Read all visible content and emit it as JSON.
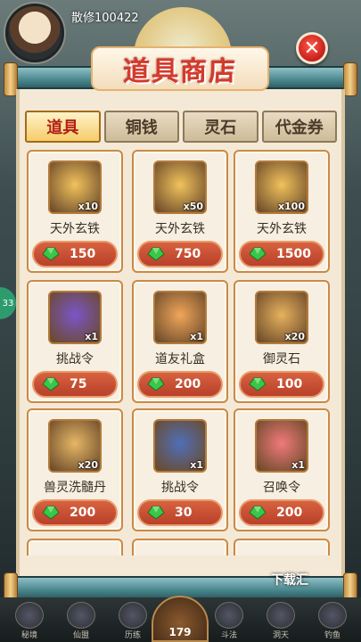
{
  "header": {
    "player_name": "散修100422"
  },
  "shop": {
    "title": "道具商店",
    "close_glyph": "✕"
  },
  "tabs": [
    {
      "label": "道具",
      "active": true
    },
    {
      "label": "铜钱",
      "active": false
    },
    {
      "label": "灵石",
      "active": false
    },
    {
      "label": "代金券",
      "active": false
    }
  ],
  "items": [
    {
      "name": "天外玄铁",
      "qty": "x10",
      "price": "150",
      "icon": "meteor-iron-icon",
      "color": "#f1c25c"
    },
    {
      "name": "天外玄铁",
      "qty": "x50",
      "price": "750",
      "icon": "meteor-iron-icon",
      "color": "#f1c25c"
    },
    {
      "name": "天外玄铁",
      "qty": "x100",
      "price": "1500",
      "icon": "meteor-iron-icon",
      "color": "#f1c25c"
    },
    {
      "name": "挑战令",
      "qty": "x1",
      "price": "75",
      "icon": "challenge-token-icon",
      "color": "#7b55c9"
    },
    {
      "name": "道友礼盒",
      "qty": "x1",
      "price": "200",
      "icon": "gift-box-icon",
      "color": "#f0a65a"
    },
    {
      "name": "御灵石",
      "qty": "x20",
      "price": "100",
      "icon": "spirit-stone-icon",
      "color": "#e7b15e"
    },
    {
      "name": "兽灵洗髓丹",
      "qty": "x20",
      "price": "200",
      "icon": "pill-icon",
      "color": "#e6b767"
    },
    {
      "name": "挑战令",
      "qty": "x1",
      "price": "30",
      "icon": "challenge-token-icon",
      "color": "#4f6fb8"
    },
    {
      "name": "召唤令",
      "qty": "x1",
      "price": "200",
      "icon": "summon-token-icon",
      "color": "#f07a7a"
    }
  ],
  "side_badge": "33",
  "bottom_nav": {
    "items": [
      "秘境",
      "仙盟",
      "历练",
      "斗法",
      "洞天",
      "钓鱼"
    ],
    "center_value": "179"
  },
  "watermark": "下载汇",
  "colors": {
    "accent": "#d43a2c",
    "price_bg": "#c24a30",
    "panel": "#f4e9d6"
  }
}
